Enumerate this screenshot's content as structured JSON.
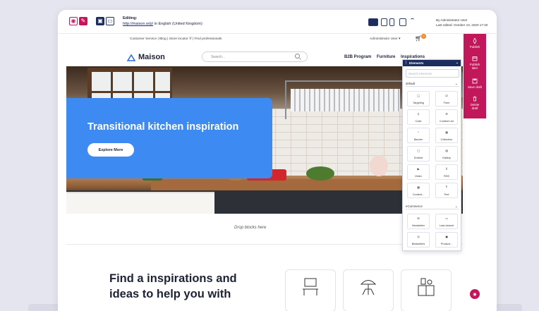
{
  "editor": {
    "editing_label": "Editing:",
    "url": "http://maison.w/p/",
    "language": " in English (United Kingdom)",
    "author_line": "By Administrator User",
    "edited_line": "Last edited: October 10, 2020 17:20"
  },
  "site": {
    "util_links": "Customer Service  |  Blog  |  Store locator  ⚲  |  Find professionals",
    "user_menu": "Administrator User  ▾",
    "cart_count": "0",
    "logo": "Maison",
    "search_placeholder": "Search...",
    "nav": [
      "B2B Program",
      "Furniture",
      "Inspirations"
    ]
  },
  "hero": {
    "title": "Transitional kitchen inspiration",
    "button": "Explore More"
  },
  "drop_hint": "Drop blocks here",
  "find": {
    "title": "Find a inspirations and ideas to help you with"
  },
  "rail": [
    {
      "label": "Publish",
      "icon": "rocket-icon"
    },
    {
      "label": "Publish later",
      "icon": "calendar-icon"
    },
    {
      "label": "Save draft",
      "icon": "save-icon"
    },
    {
      "label": "Delete draft",
      "icon": "trash-icon"
    }
  ],
  "panel": {
    "title": "Elements",
    "search_placeholder": "Search elements",
    "group_default": "default",
    "group_ecommerce": "eCommerce",
    "default_items": [
      "Targeting",
      "Form",
      "Code",
      "Content List",
      "Banner",
      "Collection",
      "Embed",
      "Gallery",
      "Video",
      "RSS",
      "Content...",
      "Text"
    ],
    "ecommerce_items": [
      "Newsletter",
      "Last viewed",
      "Bestsellers",
      "Product..."
    ]
  },
  "colors": {
    "accent": "#c2185b",
    "hero_card": "#3d8bf2",
    "panel_header": "#1c2c5e",
    "cart_badge": "#f48120"
  }
}
